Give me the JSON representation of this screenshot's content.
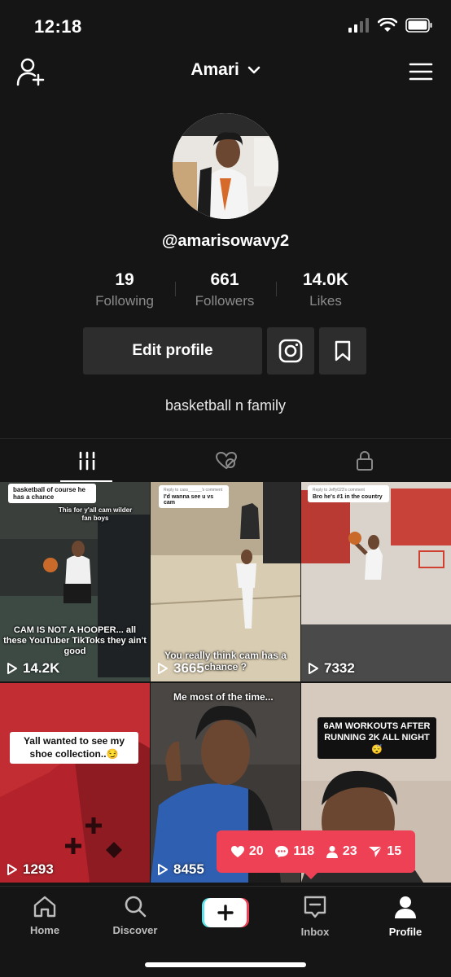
{
  "status_bar": {
    "time": "12:18"
  },
  "header": {
    "title": "Amari"
  },
  "profile": {
    "handle": "@amarisowavy2",
    "stats": [
      {
        "value": "19",
        "label": "Following"
      },
      {
        "value": "661",
        "label": "Followers"
      },
      {
        "value": "14.0K",
        "label": "Likes"
      }
    ],
    "edit_button": "Edit profile",
    "bio": "basketball n family"
  },
  "tabs": [
    {
      "name": "videos",
      "icon": "grid-icon",
      "active": true
    },
    {
      "name": "liked",
      "icon": "heart-hidden-icon",
      "active": false
    },
    {
      "name": "private",
      "icon": "lock-icon",
      "active": false
    }
  ],
  "videos": [
    {
      "views": "14.2K",
      "bubble": "basketball of course he has a chance",
      "top_text": "This for y'all cam wilder fan boys",
      "overlay": "CAM IS NOT A HOOPER... all these YouTuber TikToks they ain't good"
    },
    {
      "views": "3665",
      "bubble_small": "Reply to cass______'s comment",
      "bubble": "I'd wanna see u vs cam",
      "overlay": "You really think cam has a chance ?"
    },
    {
      "views": "7332",
      "bubble_small": "Reply to Jeffy023's comment",
      "bubble": "Bro he's #1 in the country"
    },
    {
      "views": "1293",
      "label": "Yall wanted to see my shoe collection..😏"
    },
    {
      "views": "8455",
      "top_text": "Me most of the time..."
    },
    {
      "views": "",
      "label": "6AM WORKOUTS AFTER RUNNING 2K ALL NIGHT 😴"
    }
  ],
  "notifications": {
    "likes": "20",
    "comments": "118",
    "followers": "23",
    "mentions": "15"
  },
  "bottom_nav": [
    {
      "label": "Home",
      "icon": "home-icon"
    },
    {
      "label": "Discover",
      "icon": "search-icon"
    },
    {
      "label": "",
      "icon": "create-plus-icon"
    },
    {
      "label": "Inbox",
      "icon": "inbox-icon"
    },
    {
      "label": "Profile",
      "icon": "profile-icon"
    }
  ],
  "colors": {
    "background": "#151515",
    "accent": "#ee4156",
    "button": "#2d2d2d"
  }
}
